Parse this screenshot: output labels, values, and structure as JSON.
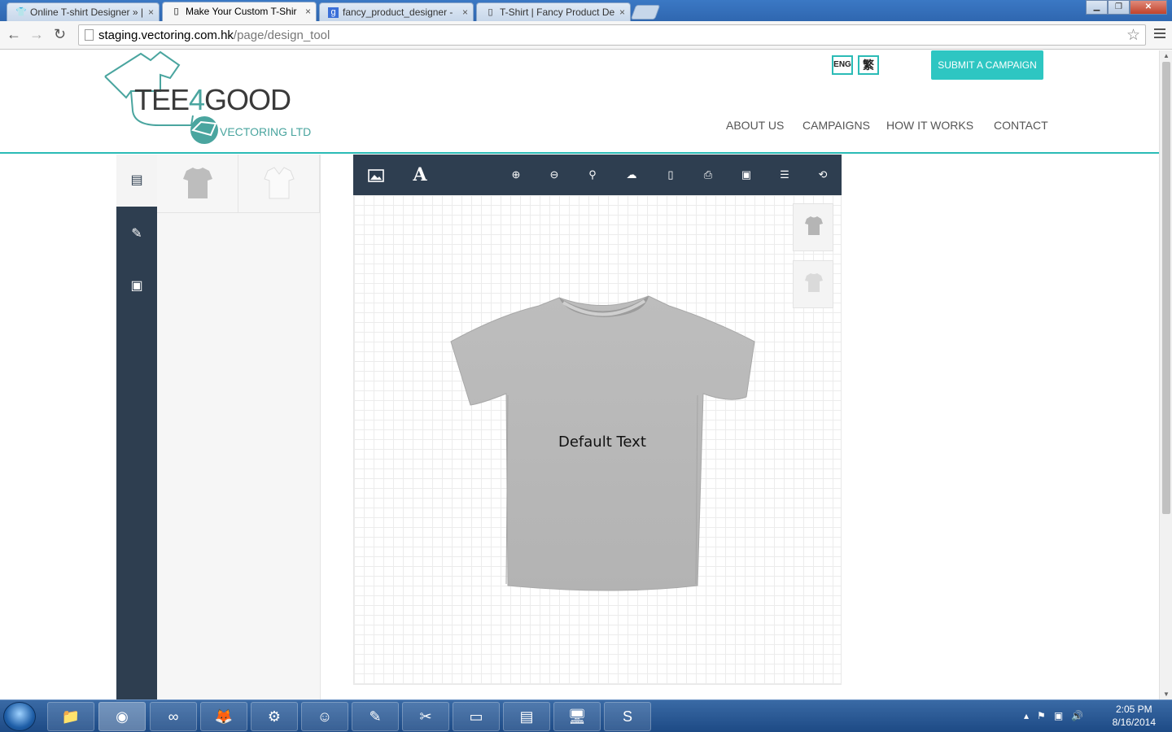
{
  "browser": {
    "tabs": [
      {
        "title": "Online T-shirt Designer » |",
        "favicon": "shirt-icon"
      },
      {
        "title": "Make Your Custom T-Shir",
        "favicon": "page-icon",
        "active": true
      },
      {
        "title": "fancy_product_designer -",
        "favicon": "google-icon"
      },
      {
        "title": "T-Shirt | Fancy Product De",
        "favicon": "page-icon"
      }
    ],
    "tab_close": "×",
    "url_host": "staging.vectoring.com.hk",
    "url_path": "/page/design_tool"
  },
  "site": {
    "logo_main": "TEE",
    "logo_four": "4",
    "logo_good": "GOOD",
    "logo_sub": "VECTORING LTD",
    "lang_eng": "ENG",
    "lang_trad": "繁",
    "submit_label": "SUBMIT A CAMPAIGN",
    "nav": [
      "ABOUT US",
      "CAMPAIGNS",
      "HOW IT WORKS",
      "CONTACT"
    ],
    "accent": "#2bbbb6",
    "dark": "#2e3e50"
  },
  "designer": {
    "sidebar_icons": [
      "book-icon",
      "edit-icon",
      "instagram-icon"
    ],
    "toolbar_icons": [
      "image-icon",
      "text-icon",
      "zoom-in-icon",
      "zoom-out-icon",
      "zoom-reset-icon",
      "cloud-download-icon",
      "file-icon",
      "print-icon",
      "save-icon",
      "list-icon",
      "refresh-icon"
    ],
    "text_tool_glyph": "A",
    "canvas_text": "Default Text"
  },
  "taskbar": {
    "time": "2:05 PM",
    "date": "8/16/2014"
  }
}
